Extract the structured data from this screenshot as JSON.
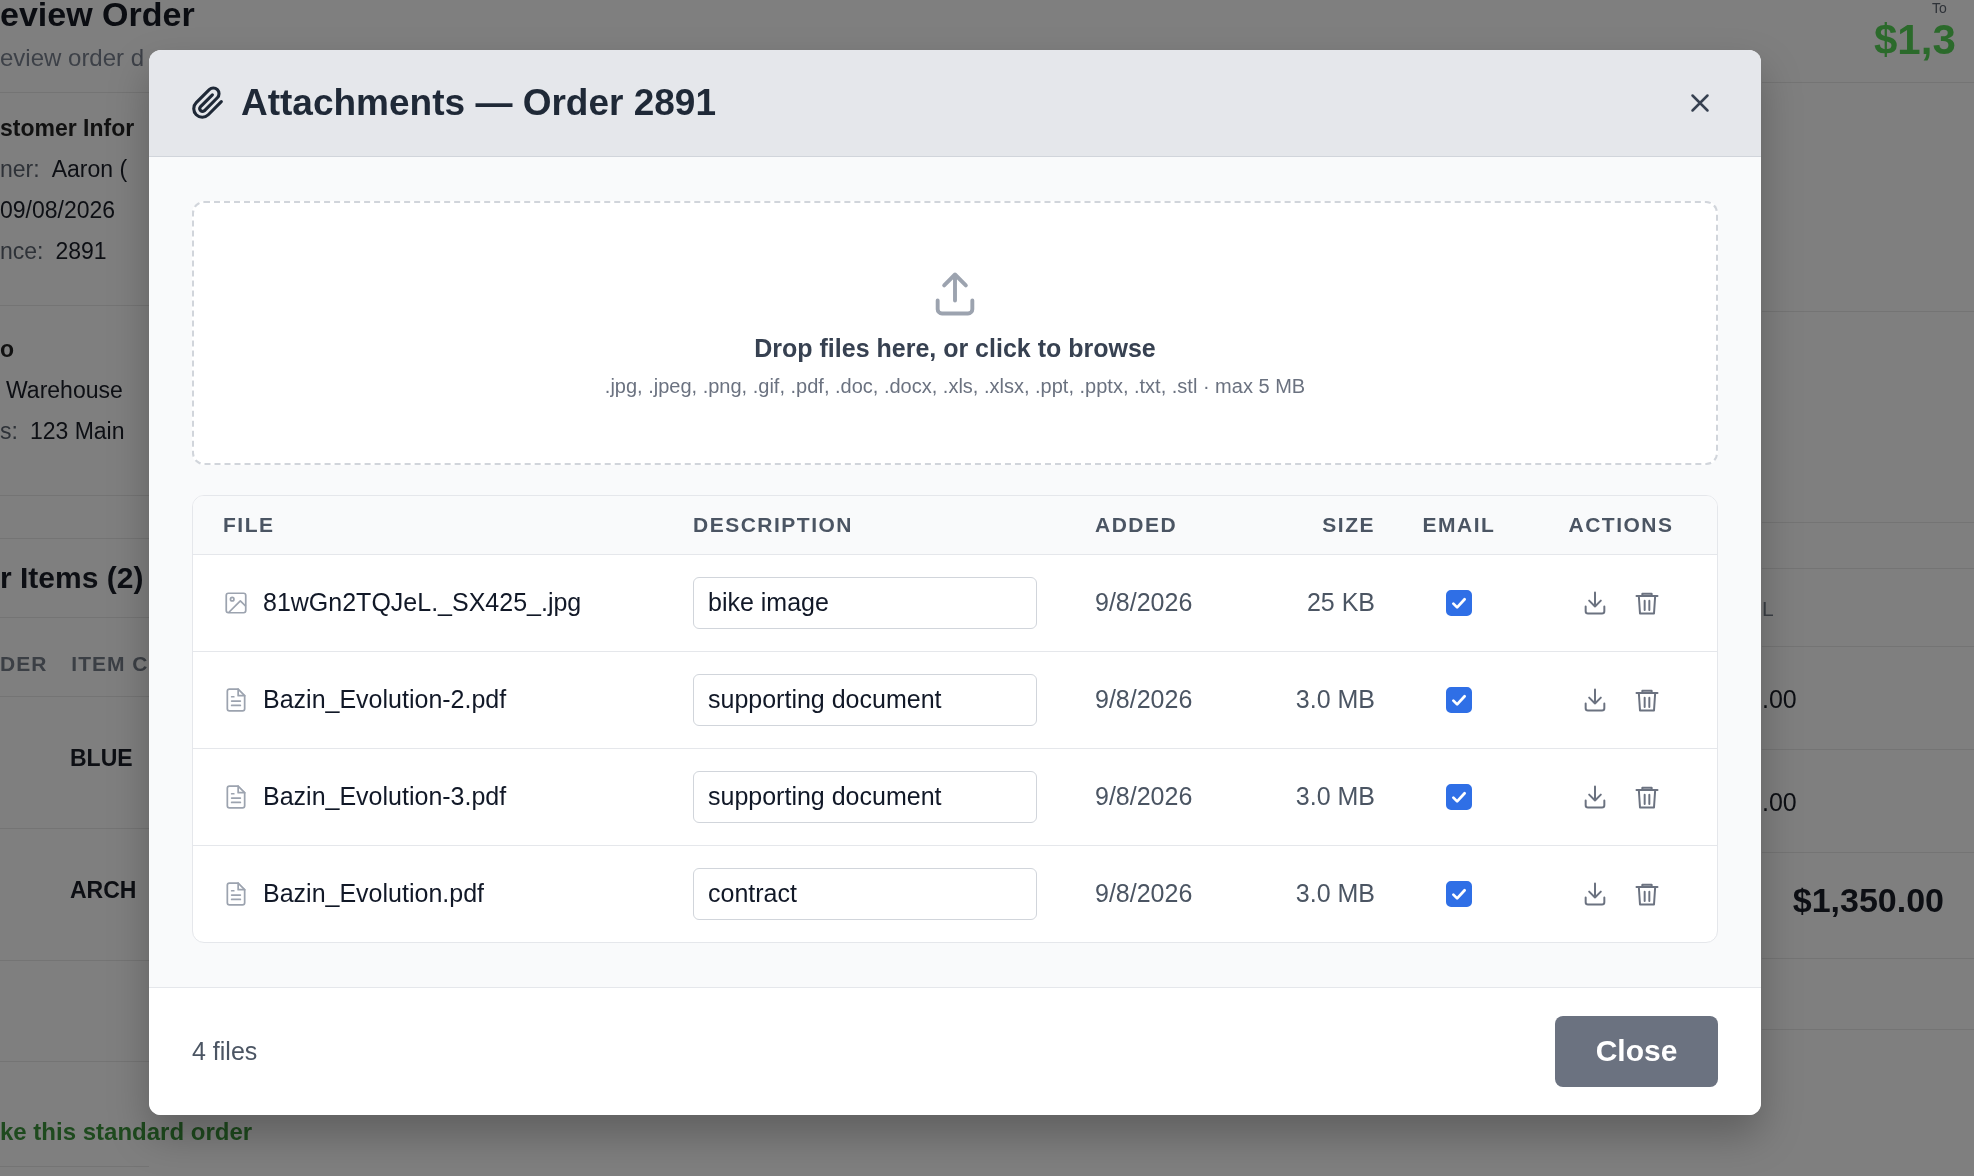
{
  "background": {
    "title": "eview Order",
    "subtitle": "eview order d",
    "section_1": "stomer Infor",
    "fields": [
      {
        "label": "ner:",
        "value": "Aaron ("
      },
      {
        "value": "09/08/2026"
      },
      {
        "label": "nce:",
        "value": "2891"
      }
    ],
    "section_2": "o",
    "fields_2": [
      {
        "value": "Warehouse"
      },
      {
        "label": "s:",
        "value": "123 Main"
      }
    ],
    "items_title": "r Items (2)",
    "columns": [
      "DER",
      "ITEM C"
    ],
    "rows": [
      "BLUE",
      "ARCH"
    ],
    "link": "ke this standard order",
    "total_label": "To",
    "total": "$1,3",
    "column_right": "L",
    "row_totals": [
      ".00",
      ".00"
    ],
    "grand_total": "$1,350.00"
  },
  "dialog": {
    "title": "Attachments — Order 2891",
    "dropzone": {
      "text": "Drop files here, or click to browse",
      "hint": ".jpg, .jpeg, .png, .gif, .pdf, .doc, .docx, .xls, .xlsx, .ppt, .pptx, .txt, .stl · max 5 MB"
    },
    "columns": [
      "FILE",
      "DESCRIPTION",
      "ADDED",
      "SIZE",
      "EMAIL",
      "ACTIONS"
    ],
    "files": [
      {
        "kind": "image",
        "name": "81wGn2TQJeL._SX425_.jpg",
        "description": "bike image",
        "added": "9/8/2026",
        "size": "25 KB",
        "email": true
      },
      {
        "kind": "document",
        "name": "Bazin_Evolution-2.pdf",
        "description": "supporting document",
        "added": "9/8/2026",
        "size": "3.0 MB",
        "email": true
      },
      {
        "kind": "document",
        "name": "Bazin_Evolution-3.pdf",
        "description": "supporting document",
        "added": "9/8/2026",
        "size": "3.0 MB",
        "email": true
      },
      {
        "kind": "document",
        "name": "Bazin_Evolution.pdf",
        "description": "contract",
        "added": "9/8/2026",
        "size": "3.0 MB",
        "email": true
      }
    ],
    "count": "4 files",
    "close_button": "Close"
  }
}
